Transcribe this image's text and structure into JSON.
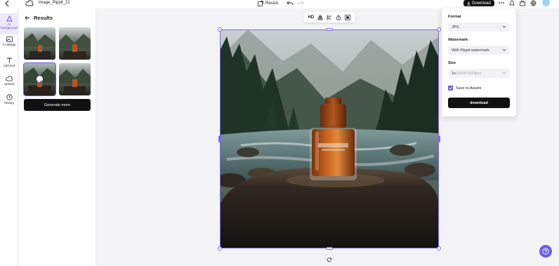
{
  "header": {
    "project_name": "image_Pippit_21",
    "resize_label": "Resize",
    "download_label": "Download",
    "icons": [
      "back-arrow-icon",
      "cloud-icon",
      "undo-icon",
      "redo-icon",
      "more-icon",
      "bell-icon",
      "briefcase-icon",
      "globe-icon",
      "avatar"
    ]
  },
  "rail": {
    "items": [
      {
        "label": "AI background",
        "icon": "sparkle-triangle-icon",
        "active": true
      },
      {
        "label": "AI design",
        "icon": "image-icon"
      },
      {
        "label": "Add text",
        "icon": "text-icon"
      },
      {
        "label": "Upload",
        "icon": "cloud-upload-icon"
      },
      {
        "label": "History",
        "icon": "clock-icon"
      }
    ]
  },
  "results": {
    "title": "Results",
    "generate_more_label": "Generate more",
    "thumbnails": [
      {
        "name": "result-1",
        "selected": false
      },
      {
        "name": "result-2",
        "selected": false
      },
      {
        "name": "result-3",
        "selected": true
      },
      {
        "name": "result-4",
        "selected": false
      }
    ]
  },
  "image_toolbar": {
    "hd_label": "HD",
    "tools": [
      "flip-icon",
      "align-icon",
      "opacity-icon",
      "crop-icon"
    ]
  },
  "export": {
    "format_label": "Format",
    "format_value": "JPG",
    "watermark_label": "Watermark",
    "watermark_value": "With Pippit watermark",
    "size_label": "Size",
    "size_value": "1x",
    "size_hint": "(1024*1024px)",
    "save_assets_label": "Save to Assets",
    "save_assets_checked": true,
    "download_label": "download"
  },
  "colors": {
    "accent": "#6b5ce7",
    "dark_button": "#111111",
    "rail_active_bg": "#ede9fb"
  }
}
